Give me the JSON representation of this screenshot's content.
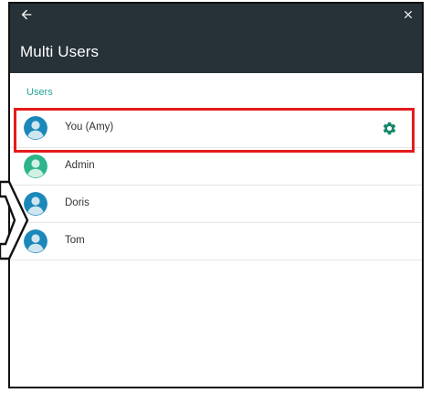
{
  "window": {
    "title": "Multi Users"
  },
  "toolbar": {
    "back_icon": "arrow-back-icon",
    "close_icon": "close-icon"
  },
  "section": {
    "label": "Users"
  },
  "users": [
    {
      "name": "You (Amy)",
      "avatar_color": "#1c88ba",
      "has_settings": true,
      "highlighted": true
    },
    {
      "name": "Admin",
      "avatar_color": "#2db48a",
      "has_settings": false,
      "highlighted": false
    },
    {
      "name": "Doris",
      "avatar_color": "#1c88ba",
      "has_settings": false,
      "highlighted": false
    },
    {
      "name": "Tom",
      "avatar_color": "#1c88ba",
      "has_settings": false,
      "highlighted": false
    }
  ],
  "colors": {
    "appbar": "#263238",
    "accent": "#26a69a",
    "gear": "#14876b",
    "highlight_border": "#e51b1b"
  }
}
